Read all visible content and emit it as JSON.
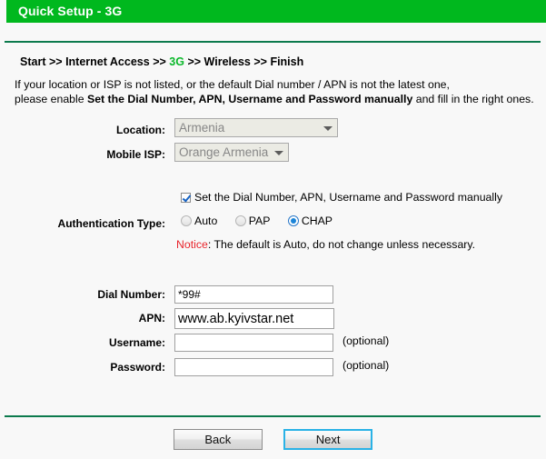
{
  "header": {
    "title": "Quick Setup - 3G",
    "accent_color": "#00b81e",
    "rule_color": "#0c7a4d"
  },
  "breadcrumb": {
    "steps": [
      "Start",
      "Internet Access",
      "3G",
      "Wireless",
      "Finish"
    ],
    "separator": ">>",
    "current_step": "3G",
    "current_color": "#0ab82a"
  },
  "intro": {
    "line1": "If your location or ISP is not listed, or the default Dial number / APN is not the latest one,",
    "line2_prefix": "please enable ",
    "line2_bold": "Set the Dial Number, APN, Username and Password manually",
    "line2_suffix": " and fill in the right ones."
  },
  "form": {
    "location": {
      "label": "Location:",
      "value": "Armenia",
      "disabled": "true",
      "icon": "chevron-down-icon"
    },
    "mobile_isp": {
      "label": "Mobile ISP:",
      "value": "Orange Armenia",
      "disabled": "true",
      "icon": "chevron-down-icon"
    },
    "manual_checkbox": {
      "label": "Set the Dial Number, APN, Username and Password manually",
      "checked": "true"
    },
    "auth_type": {
      "label": "Authentication Type:",
      "options": [
        "Auto",
        "PAP",
        "CHAP"
      ],
      "selected": "CHAP"
    },
    "notice": {
      "prefix": "Notice",
      "text": ": The default is Auto, do not change unless necessary.",
      "color": "#e8262d"
    },
    "dial_number": {
      "label": "Dial Number:",
      "value": "*99#",
      "placeholder": ""
    },
    "apn": {
      "label": "APN:",
      "value": "www.ab.kyivstar.net",
      "placeholder": ""
    },
    "username": {
      "label": "Username:",
      "value": "",
      "placeholder": "",
      "hint": "(optional)"
    },
    "password": {
      "label": "Password:",
      "value": "",
      "placeholder": "",
      "hint": "(optional)"
    }
  },
  "buttons": {
    "back": "Back",
    "next": "Next",
    "focused": "Next",
    "focus_color": "#2ab2e6"
  }
}
